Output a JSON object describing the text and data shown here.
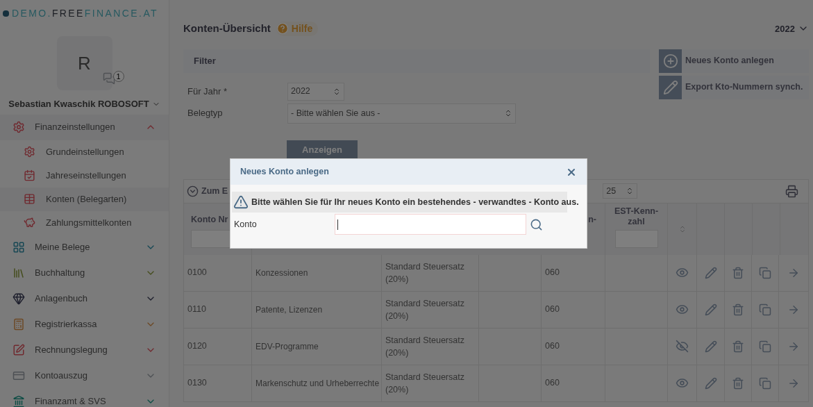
{
  "logo": [
    "DEMO.",
    "FREE",
    "FINANCE.AT"
  ],
  "user": {
    "initial": "R",
    "badge": "1",
    "name": "Sebastian Kwaschik ROBOSOFT"
  },
  "sidebar": {
    "items": [
      {
        "label": "Finanzeinstellungen",
        "expanded": true,
        "children": [
          {
            "label": "Grundeinstellungen",
            "selected": false
          },
          {
            "label": "Jahreseinstellungen",
            "selected": false
          },
          {
            "label": "Konten (Belegarten)",
            "selected": true
          },
          {
            "label": "Zahlungsmittelkonten",
            "selected": false
          }
        ]
      },
      {
        "label": "Meine Belege",
        "expanded": false
      },
      {
        "label": "Buchhaltung",
        "expanded": false
      },
      {
        "label": "Anlagenbuch",
        "expanded": false
      },
      {
        "label": "Registrierkassa",
        "expanded": false
      },
      {
        "label": "Rechnungslegung",
        "expanded": false
      },
      {
        "label": "Kontoauszug",
        "expanded": false
      },
      {
        "label": "Finanzamt & SVS",
        "expanded": false
      }
    ]
  },
  "page": {
    "title": "Konten-Übersicht",
    "help": "Hilfe",
    "year": "2022"
  },
  "filter": {
    "title": "Filter",
    "fields": [
      {
        "label": "Für Jahr *",
        "value": "2022"
      },
      {
        "label": "Belegtyp",
        "value": "- Bitte wählen Sie aus -"
      }
    ],
    "submit": "Anzeigen"
  },
  "actions": [
    "Neues Konto anlegen",
    "Export Kto-Nummern synch."
  ],
  "table": {
    "toolbar": {
      "collapse": "Zum E",
      "page_size": "25"
    },
    "columns": [
      "Konto Nr",
      "n-",
      "EST-Kenn-zahl"
    ],
    "rows": [
      {
        "konto": "0100",
        "name": "Konzessionen",
        "tax": "Standard Steuersatz (20%)",
        "code": "060",
        "visible": true
      },
      {
        "konto": "0110",
        "name": "Patente, Lizenzen",
        "tax": "Standard Steuersatz (20%)",
        "code": "060",
        "visible": true
      },
      {
        "konto": "0120",
        "name": "EDV-Programme",
        "tax": "Standard Steuersatz (20%)",
        "code": "060",
        "visible": false
      },
      {
        "konto": "0130",
        "name": "Markenschutz und Urheberrechte",
        "tax": "Standard Steuersatz (20%)",
        "code": "060",
        "visible": true
      }
    ]
  },
  "dialog": {
    "title": "Neues Konto anlegen",
    "warning": "Bitte wählen Sie für Ihr neues Konto ein bestehendes - verwandtes - Konto aus.",
    "field_label": "Konto"
  }
}
